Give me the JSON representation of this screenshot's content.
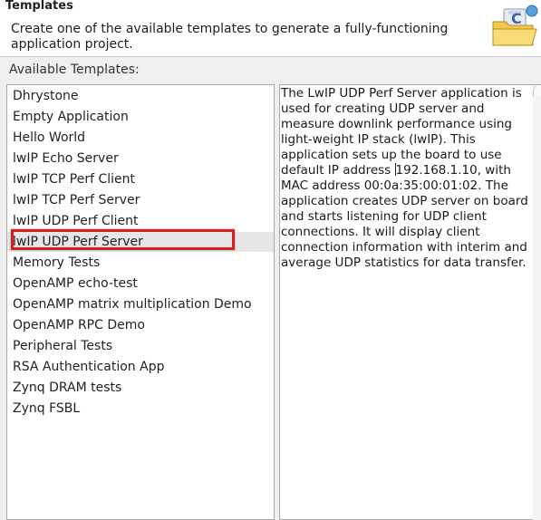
{
  "header": {
    "title": "Templates",
    "description": "Create one of the available templates to generate a fully-functioning application project."
  },
  "available_label": "Available Templates:",
  "templates": [
    {
      "label": "Dhrystone"
    },
    {
      "label": "Empty Application"
    },
    {
      "label": "Hello World"
    },
    {
      "label": "lwIP Echo Server"
    },
    {
      "label": "lwIP TCP Perf Client"
    },
    {
      "label": "lwIP TCP Perf Server"
    },
    {
      "label": "lwIP UDP Perf Client"
    },
    {
      "label": "lwIP UDP Perf Server",
      "selected": true
    },
    {
      "label": "Memory Tests"
    },
    {
      "label": "OpenAMP echo-test"
    },
    {
      "label": "OpenAMP matrix multiplication Demo"
    },
    {
      "label": "OpenAMP RPC Demo"
    },
    {
      "label": "Peripheral Tests"
    },
    {
      "label": "RSA Authentication App"
    },
    {
      "label": "Zynq DRAM tests"
    },
    {
      "label": "Zynq FSBL"
    }
  ],
  "selected_description": {
    "before_caret": "The LwIP UDP Perf Server application is used for creating UDP server and measure downlink performance using light-weight IP stack (lwIP). This application sets up the board to use default IP address ",
    "after_caret": "192.168.1.10, with MAC address 00:0a:35:00:01:02. The application creates UDP server on board and starts listening for UDP client connections. It will display client connection information with interim and average UDP statistics for data transfer."
  },
  "icons": {
    "wizard": "new-c-project-folder-icon",
    "scroll": "scroll-up-arrow-icon"
  },
  "colors": {
    "highlight": "#d61f1f",
    "selected_row": "#e6e6e6"
  }
}
